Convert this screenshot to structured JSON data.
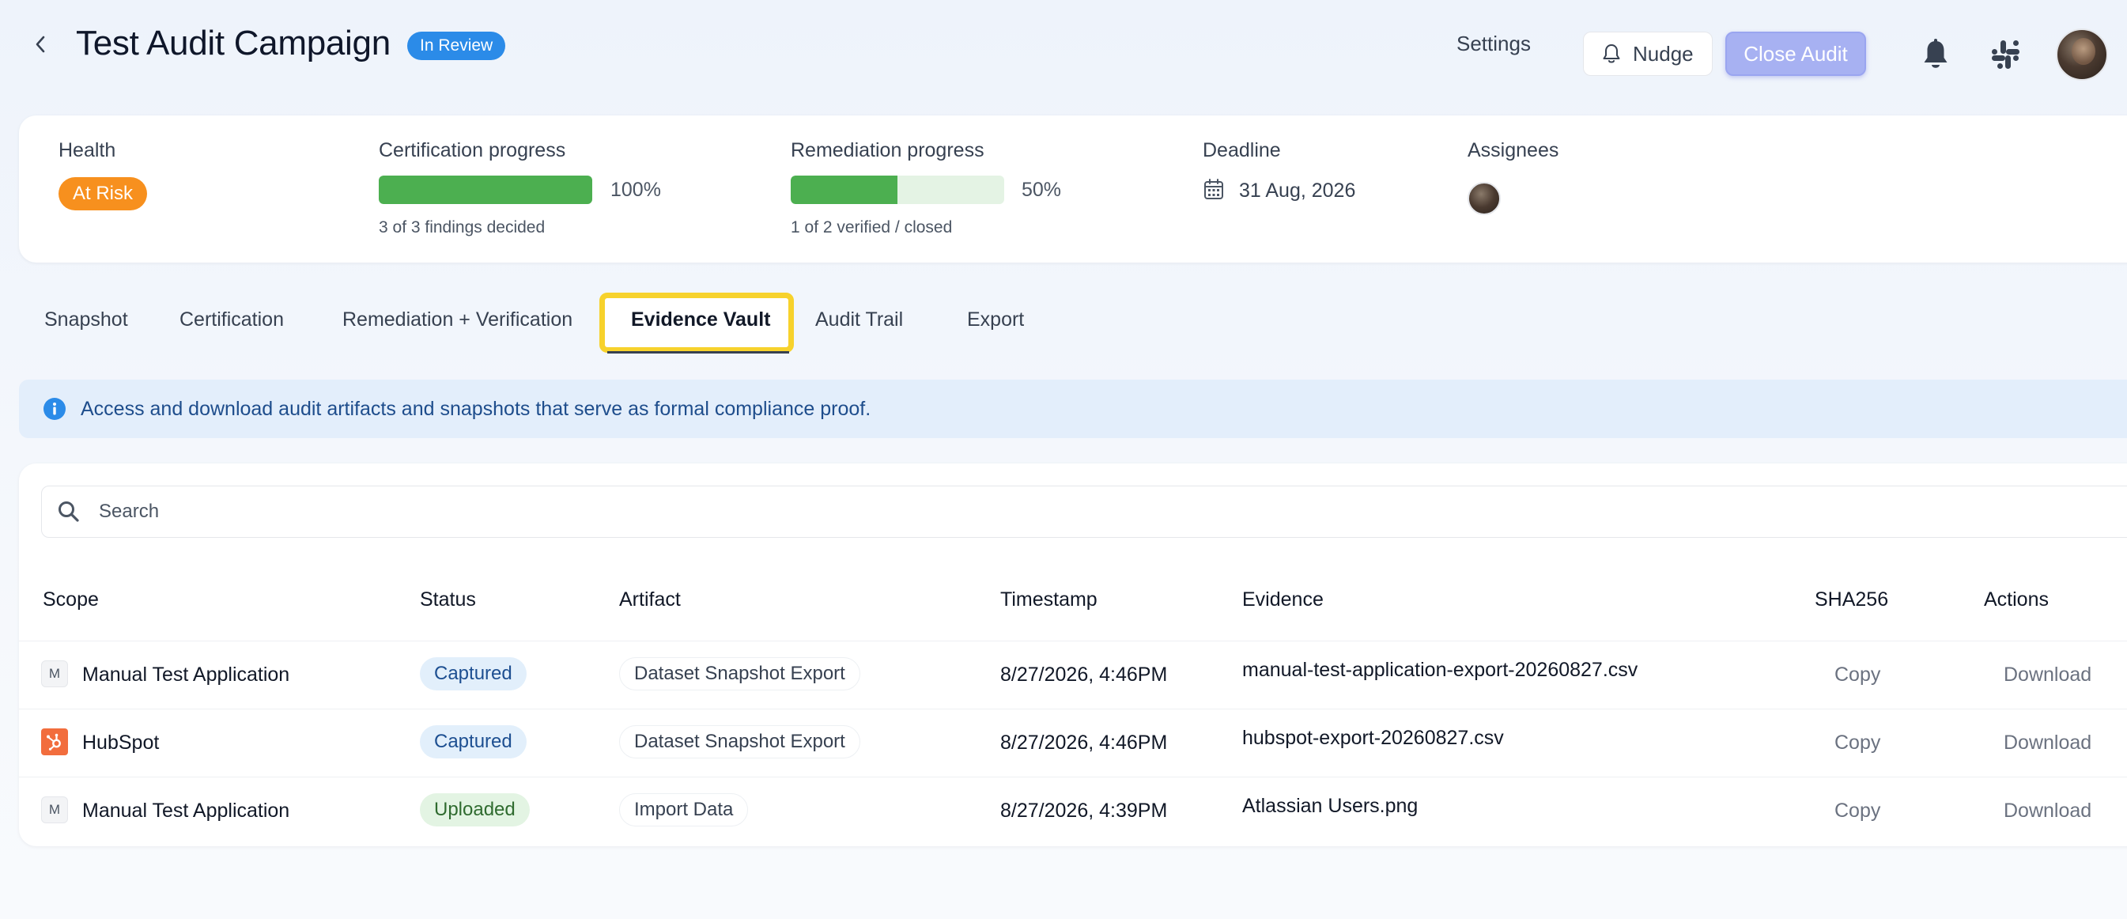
{
  "header": {
    "title": "Test Audit Campaign",
    "status": "In Review",
    "settings_label": "Settings",
    "nudge_label": "Nudge",
    "close_audit_label": "Close Audit"
  },
  "summary": {
    "health_label": "Health",
    "health_value": "At Risk",
    "certification": {
      "label": "Certification progress",
      "percent_text": "100%",
      "percent": 100,
      "sub": "3 of 3 findings decided"
    },
    "remediation": {
      "label": "Remediation progress",
      "percent_text": "50%",
      "percent": 50,
      "sub": "1 of 2 verified / closed"
    },
    "deadline_label": "Deadline",
    "deadline_value": "31 Aug, 2026",
    "assignees_label": "Assignees"
  },
  "tabs": [
    {
      "label": "Snapshot"
    },
    {
      "label": "Certification"
    },
    {
      "label": "Remediation + Verification"
    },
    {
      "label": "Evidence Vault",
      "active": true
    },
    {
      "label": "Audit Trail"
    },
    {
      "label": "Export"
    }
  ],
  "info_banner": "Access and download audit artifacts and snapshots that serve as formal compliance proof.",
  "search": {
    "placeholder": "Search"
  },
  "table": {
    "columns": [
      "Scope",
      "Status",
      "Artifact",
      "Timestamp",
      "Evidence",
      "SHA256",
      "Actions"
    ],
    "rows": [
      {
        "scope_icon": "M",
        "scope": "Manual Test Application",
        "status": "Captured",
        "artifact": "Dataset Snapshot Export",
        "timestamp": "8/27/2026, 4:46PM",
        "evidence": "manual-test-application-export-20260827.csv",
        "sha": "Copy",
        "action": "Download"
      },
      {
        "scope_icon": "hubspot-logo-icon",
        "scope": "HubSpot",
        "status": "Captured",
        "artifact": "Dataset Snapshot Export",
        "timestamp": "8/27/2026, 4:46PM",
        "evidence": "hubspot-export-20260827.csv",
        "sha": "Copy",
        "action": "Download"
      },
      {
        "scope_icon": "M",
        "scope": "Manual Test Application",
        "status": "Uploaded",
        "artifact": "Import Data",
        "timestamp": "8/27/2026, 4:39PM",
        "evidence": "Atlassian Users.png",
        "sha": "Copy",
        "action": "Download"
      }
    ]
  }
}
